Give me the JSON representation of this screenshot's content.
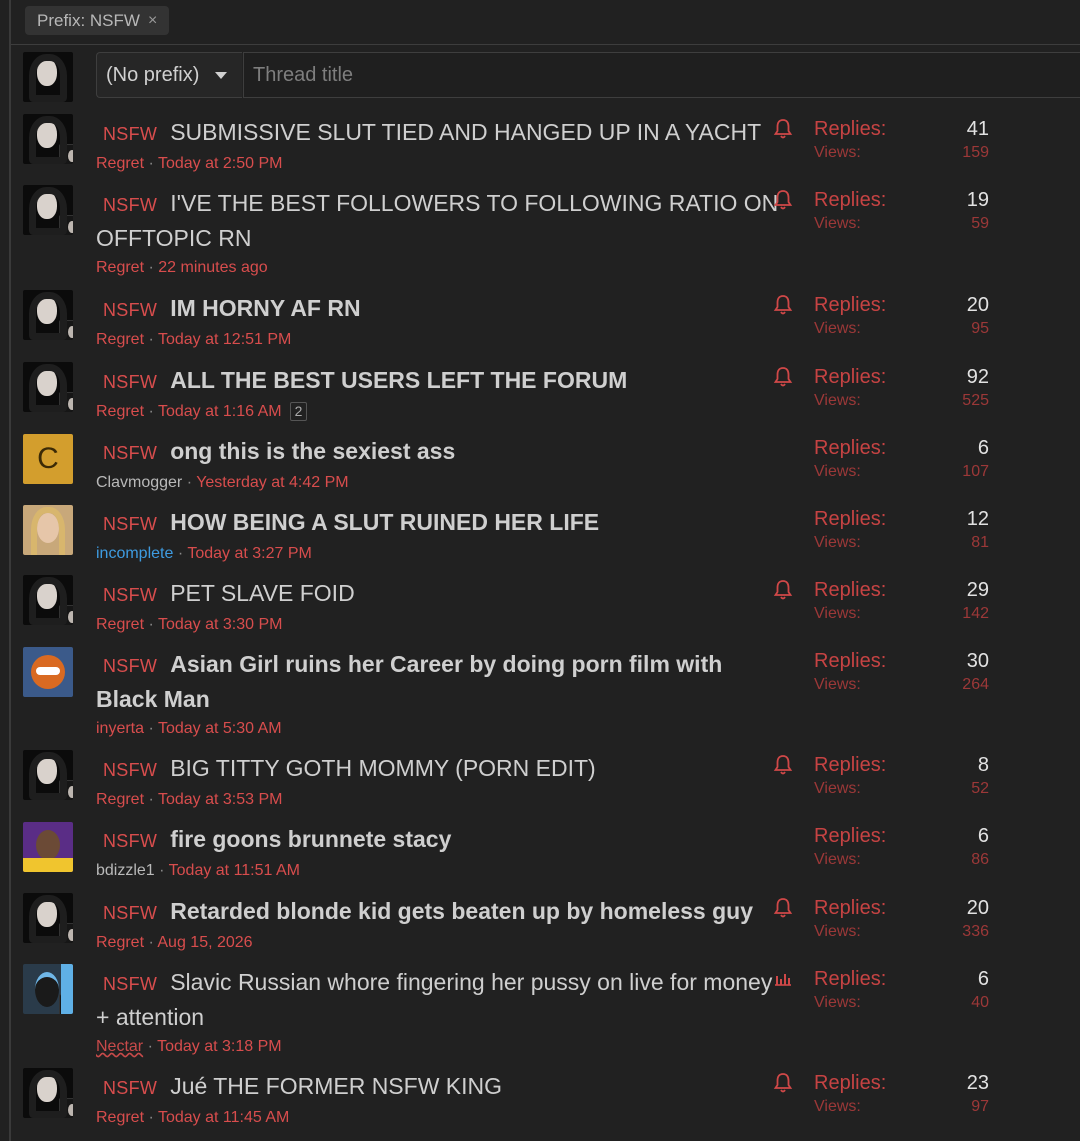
{
  "filter": {
    "chip_label": "Prefix: NSFW",
    "chip_close": "×"
  },
  "new_thread": {
    "prefix_select": "(No prefix)",
    "title_placeholder": "Thread title"
  },
  "labels": {
    "replies": "Replies:",
    "views": "Views:",
    "nsfw": "NSFW"
  },
  "threads": [
    {
      "title": "SUBMISSIVE SLUT TIED AND HANGED UP IN A YACHT",
      "bold": false,
      "author": "Regret",
      "time": "Today at 2:50 PM",
      "replies": "41",
      "views": "159",
      "watch": true
    },
    {
      "title": "I'VE THE BEST FOLLOWERS TO FOLLOWING RATIO ON OFFTOPIC RN",
      "bold": false,
      "author": "Regret",
      "time": "22 minutes ago",
      "replies": "19",
      "views": "59",
      "watch": true
    },
    {
      "title": "IM HORNY AF RN",
      "bold": true,
      "author": "Regret",
      "time": "Today at 12:51 PM",
      "replies": "20",
      "views": "95",
      "watch": true
    },
    {
      "title": "ALL THE BEST USERS LEFT THE FORUM",
      "bold": true,
      "author": "Regret",
      "time": "Today at 1:16 AM",
      "page": "2",
      "replies": "92",
      "views": "525",
      "watch": true
    },
    {
      "title": "ong this is the sexiest ass",
      "bold": true,
      "author": "Clavmogger",
      "time": "Yesterday at 4:42 PM",
      "replies": "6",
      "views": "107",
      "avatar_letter": "C"
    },
    {
      "title": "HOW BEING A SLUT RUINED HER LIFE",
      "bold": true,
      "author": "incomplete",
      "time": "Today at 3:27 PM",
      "replies": "12",
      "views": "81"
    },
    {
      "title": "PET SLAVE FOID",
      "bold": false,
      "author": "Regret",
      "time": "Today at 3:30 PM",
      "replies": "29",
      "views": "142",
      "watch": true
    },
    {
      "title": "Asian Girl ruins her Career by doing porn film with Black Man",
      "bold": true,
      "author": "inyerta",
      "time": "Today at 5:30 AM",
      "replies": "30",
      "views": "264"
    },
    {
      "title": "BIG TITTY GOTH MOMMY (PORN EDIT)",
      "bold": false,
      "author": "Regret",
      "time": "Today at 3:53 PM",
      "replies": "8",
      "views": "52",
      "watch": true
    },
    {
      "title": "fire goons brunnete stacy",
      "bold": true,
      "author": "bdizzle1",
      "time": "Today at 11:51 AM",
      "replies": "6",
      "views": "86"
    },
    {
      "title": "Retarded blonde kid gets beaten up by homeless guy",
      "bold": true,
      "author": "Regret",
      "time": "Aug 15, 2026",
      "replies": "20",
      "views": "336",
      "watch": true
    },
    {
      "title": "Slavic Russian whore fingering her pussy on live for money + attention",
      "bold": false,
      "author": "Nectar",
      "time": "Today at 3:18 PM",
      "replies": "6",
      "views": "40",
      "poll": true
    },
    {
      "title": "Jué THE FORMER NSFW KING",
      "bold": false,
      "author": "Regret",
      "time": "Today at 11:45 AM",
      "replies": "23",
      "views": "97",
      "watch": true
    }
  ]
}
